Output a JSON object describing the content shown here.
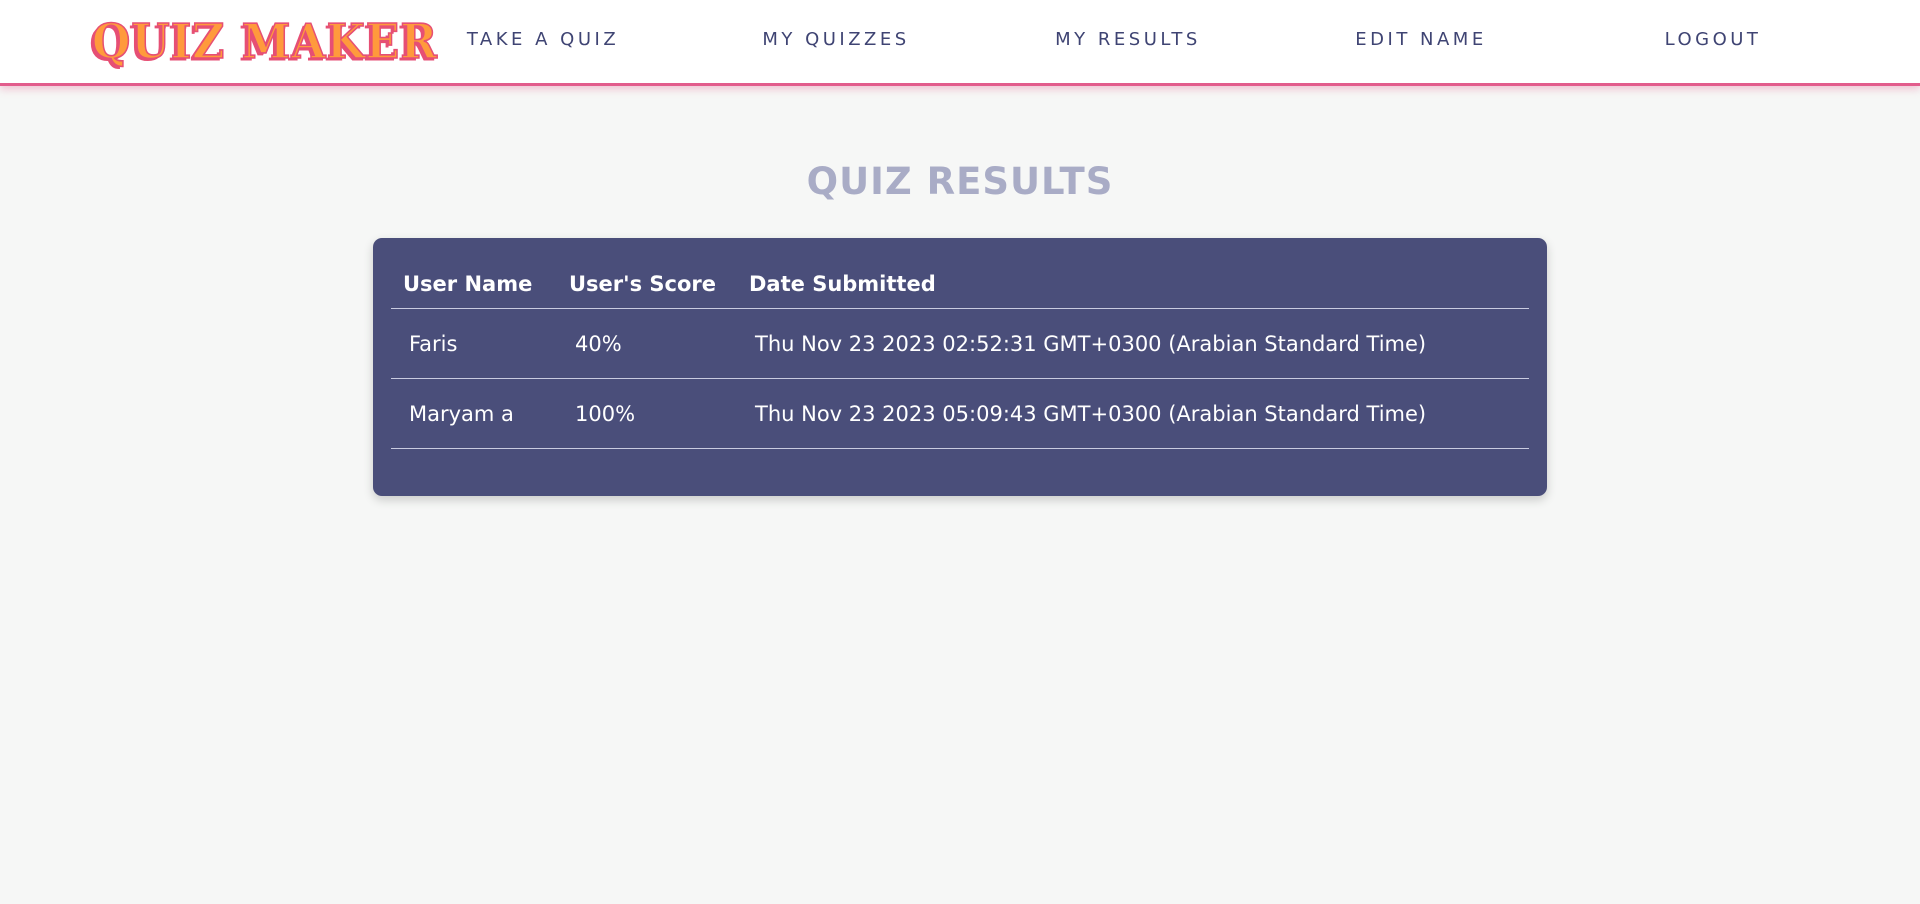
{
  "header": {
    "logo_text": "QUIZ MAKER",
    "nav": [
      {
        "label": "TAKE A QUIZ"
      },
      {
        "label": "MY QUIZZES"
      },
      {
        "label": "MY RESULTS"
      },
      {
        "label": "EDIT NAME"
      },
      {
        "label": "LOGOUT"
      }
    ]
  },
  "main": {
    "title": "QUIZ RESULTS",
    "table": {
      "columns": [
        "User Name",
        "User's Score",
        "Date Submitted"
      ],
      "rows": [
        {
          "user_name": "Faris",
          "score": "40%",
          "date": "Thu Nov 23 2023 02:52:31 GMT+0300 (Arabian Standard Time)"
        },
        {
          "user_name": "Maryam a",
          "score": "100%",
          "date": "Thu Nov 23 2023 05:09:43 GMT+0300 (Arabian Standard Time)"
        }
      ]
    }
  },
  "colors": {
    "accent_pink": "#e25c8c",
    "logo_orange": "#ff9a3c",
    "nav_text": "#3f4473",
    "title_text": "#a9acc6",
    "card_background": "#4a4e7a",
    "page_background": "#f6f7f6"
  }
}
